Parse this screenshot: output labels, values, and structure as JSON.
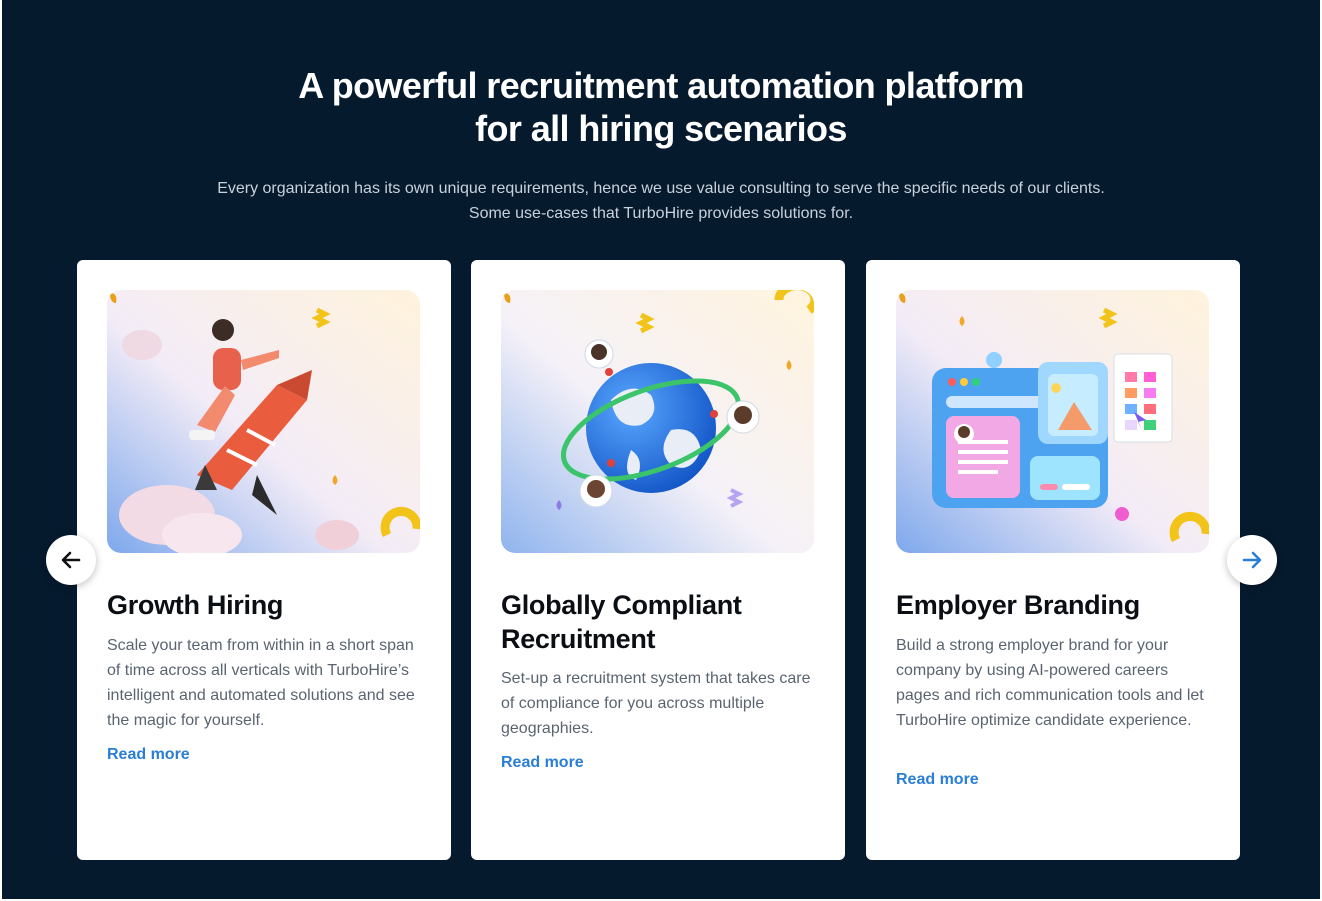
{
  "heading": {
    "line1": "A powerful recruitment automation platform",
    "line2": "for all hiring scenarios"
  },
  "subheading": {
    "line1": "Every organization has its own unique requirements, hence we use value consulting to serve the specific needs of our clients.",
    "line2": "Some use-cases that TurboHire provides solutions for."
  },
  "carousel": {
    "prev_icon": "arrow-left-icon",
    "next_icon": "arrow-right-icon",
    "next_color": "#2a7fd4",
    "cards": [
      {
        "title": "Growth Hiring",
        "description": "Scale your team from within in a short span of time across all verticals with TurboHire’s intelligent and automated solutions and see the magic for yourself.",
        "link": "Read more",
        "illustration": "rocket-rider-illustration"
      },
      {
        "title": "Globally Compliant Recruitment",
        "description": "Set-up a recruitment system that takes care of compliance for you across multiple geographies.",
        "link": "Read more",
        "illustration": "globe-network-illustration"
      },
      {
        "title": "Employer Branding",
        "description": "Build a strong employer brand for your company by using AI-powered careers pages and rich communication tools and let TurboHire optimize candidate experience.",
        "link": "Read more",
        "illustration": "career-page-illustration"
      }
    ]
  },
  "colors": {
    "background": "#061a2e",
    "accent": "#2a7fd4",
    "card": "#ffffff"
  }
}
